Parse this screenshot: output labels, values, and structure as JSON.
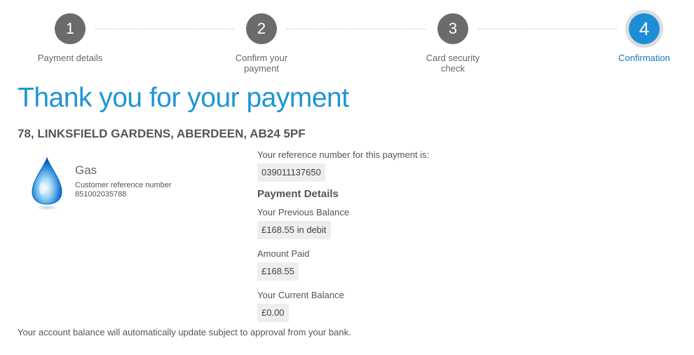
{
  "steps": [
    {
      "number": "1",
      "label": "Payment details"
    },
    {
      "number": "2",
      "label": "Confirm your payment"
    },
    {
      "number": "3",
      "label": "Card security check"
    },
    {
      "number": "4",
      "label": "Confirmation"
    }
  ],
  "active_step": 4,
  "title": "Thank you for your payment",
  "address": "78, LINKSFIELD GARDENS, ABERDEEN, AB24 5PF",
  "service": {
    "icon": "gas-flame-drop-icon",
    "name": "Gas",
    "ref_label": "Customer reference number",
    "ref_value": "851002035788"
  },
  "reference": {
    "label": "Your reference number for this payment is:",
    "value": "039011137650"
  },
  "payment_details": {
    "heading": "Payment Details",
    "previous_balance_label": "Your Previous Balance",
    "previous_balance_value": "£168.55 in debit",
    "amount_paid_label": "Amount Paid",
    "amount_paid_value": "£168.55",
    "current_balance_label": "Your Current Balance",
    "current_balance_value": "£0.00"
  },
  "footer_note": "Your account balance will automatically update subject to approval from your bank.",
  "colors": {
    "accent": "#1e95d4",
    "step_inactive": "#6b6b6b",
    "step_active": "#1d8ed6",
    "value_box_bg": "#eeeeee"
  }
}
